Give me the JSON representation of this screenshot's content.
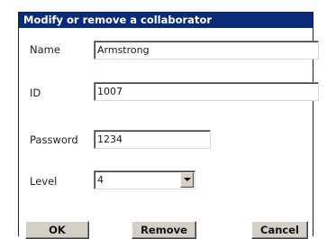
{
  "dialog": {
    "title": "Modify or remove a collaborator"
  },
  "form": {
    "name_label": "Name",
    "name_value": "Armstrong",
    "id_label": "ID",
    "id_value": "1007",
    "password_label": "Password",
    "password_value": "1234",
    "level_label": "Level",
    "level_value": "4"
  },
  "buttons": {
    "ok": "OK",
    "remove": "Remove",
    "cancel": "Cancel"
  },
  "colors": {
    "titlebar": "#0a2a7a",
    "button_face": "#d4d0c8"
  },
  "icons": {
    "dropdown": "chevron-down-icon"
  }
}
